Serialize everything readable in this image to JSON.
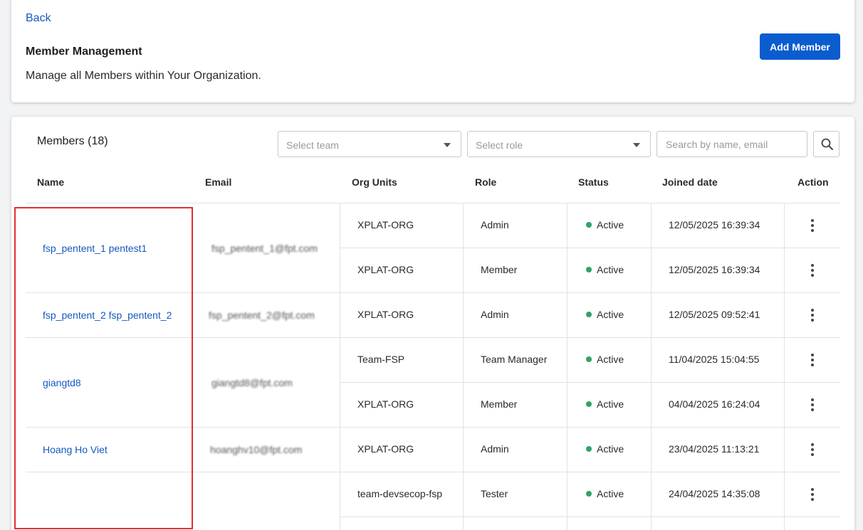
{
  "header": {
    "back_label": "Back",
    "title": "Member Management",
    "subtitle": "Manage all Members within Your Organization.",
    "add_member_label": "Add Member"
  },
  "filters": {
    "members_count_label": "Members (18)",
    "team_placeholder": "Select team",
    "role_placeholder": "Select role",
    "search_placeholder": "Search by name, email"
  },
  "table": {
    "columns": [
      "Name",
      "Email",
      "Org Units",
      "Role",
      "Status",
      "Joined date",
      "Action"
    ],
    "members": [
      {
        "name": "fsp_pentent_1 pentest1",
        "email": "fsp_pentent_1@fpt.com"
      },
      {
        "name": "fsp_pentent_2 fsp_pentent_2",
        "email": "fsp_pentent_2@fpt.com"
      },
      {
        "name": "giangtd8",
        "email": "giangtd8@fpt.com"
      },
      {
        "name": "Hoang Ho Viet",
        "email": "hoanghv10@fpt.com"
      },
      {
        "name": "",
        "email": ""
      }
    ],
    "rows": [
      {
        "org_unit": "XPLAT-ORG",
        "role": "Admin",
        "status": "Active",
        "joined": "12/05/2025 16:39:34"
      },
      {
        "org_unit": "XPLAT-ORG",
        "role": "Member",
        "status": "Active",
        "joined": "12/05/2025 16:39:34"
      },
      {
        "org_unit": "XPLAT-ORG",
        "role": "Admin",
        "status": "Active",
        "joined": "12/05/2025 09:52:41"
      },
      {
        "org_unit": "Team-FSP",
        "role": "Team Manager",
        "status": "Active",
        "joined": "11/04/2025 15:04:55"
      },
      {
        "org_unit": "XPLAT-ORG",
        "role": "Member",
        "status": "Active",
        "joined": "04/04/2025 16:24:04"
      },
      {
        "org_unit": "XPLAT-ORG",
        "role": "Admin",
        "status": "Active",
        "joined": "23/04/2025 11:13:21"
      },
      {
        "org_unit": "team-devsecop-fsp",
        "role": "Tester",
        "status": "Active",
        "joined": "24/04/2025 14:35:08"
      }
    ]
  },
  "colors": {
    "accent": "#0b5ccf",
    "link": "#1558c0",
    "status_active": "#2ea36a",
    "highlight": "#e03030"
  },
  "icons": {
    "search": "search-icon",
    "dropdown": "chevron-down-icon",
    "row_action": "more-vertical-icon"
  }
}
